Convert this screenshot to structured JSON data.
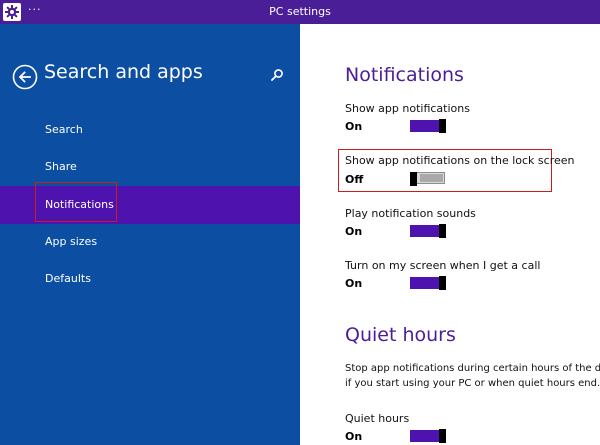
{
  "window": {
    "title": "PC settings",
    "menu_glyph": "···"
  },
  "sidebar": {
    "title": "Search and apps",
    "items": [
      {
        "label": "Search"
      },
      {
        "label": "Share"
      },
      {
        "label": "Notifications",
        "selected": true
      },
      {
        "label": "App sizes"
      },
      {
        "label": "Defaults"
      }
    ]
  },
  "main": {
    "notifications_title": "Notifications",
    "settings": [
      {
        "label": "Show app notifications",
        "state": "On"
      },
      {
        "label": "Show app notifications on the lock screen",
        "state": "Off"
      },
      {
        "label": "Play notification sounds",
        "state": "On"
      },
      {
        "label": "Turn on my screen when I get a call",
        "state": "On"
      }
    ],
    "quiet_hours_title": "Quiet hours",
    "quiet_desc_line1": "Stop app notifications during certain hours of the day.",
    "quiet_desc_line2": "if you start using your PC or when quiet hours end.",
    "quiet_hours_setting": {
      "label": "Quiet hours",
      "state": "On"
    }
  },
  "colors": {
    "titlebar": "#4a1e97",
    "sidebar_bg": "#0b4ea2",
    "selected_item": "#4e12ae",
    "accent_text": "#4a1e97",
    "toggle_on": "#4e12ae",
    "highlight_border": "#cc1b1b"
  },
  "icons": {
    "app": "gear-icon",
    "back": "back-arrow-icon",
    "search": "search-icon"
  }
}
